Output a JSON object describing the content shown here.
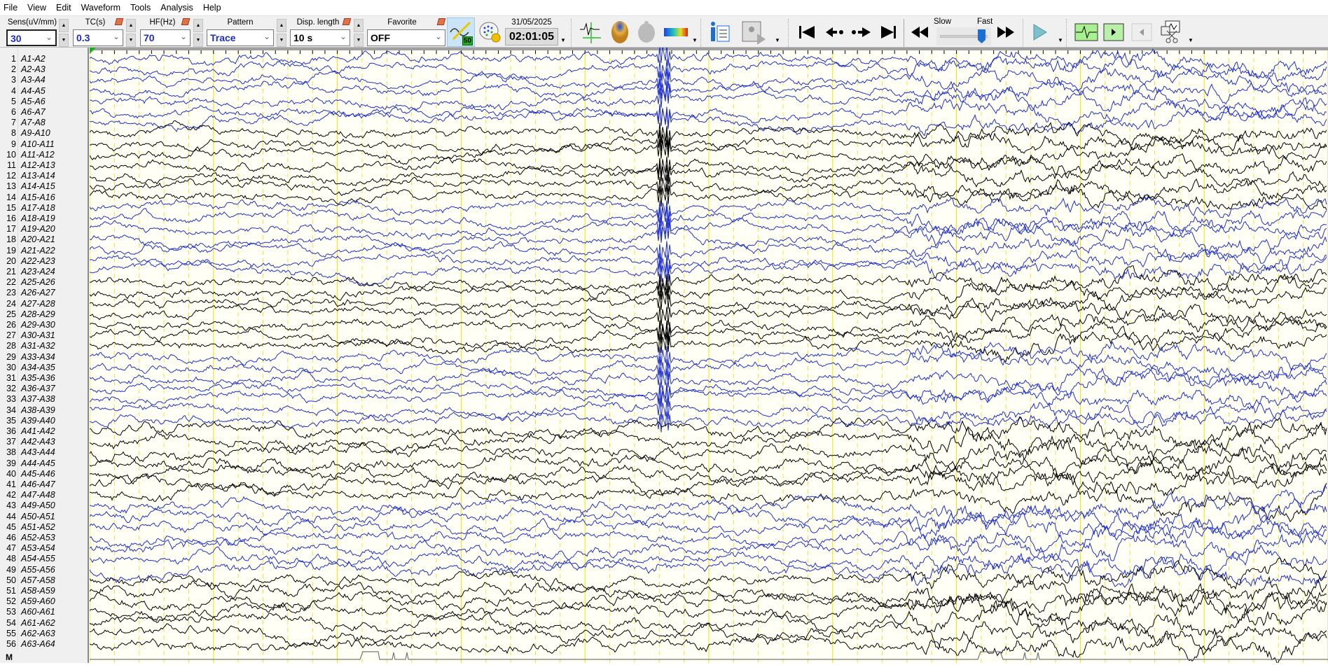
{
  "menu": [
    "File",
    "View",
    "Edit",
    "Waveform",
    "Tools",
    "Analysis",
    "Help"
  ],
  "toolbar": {
    "sens": {
      "label": "Sens(uV/mm)",
      "value": "30"
    },
    "tc": {
      "label": "TC(s)",
      "value": "0.3"
    },
    "hf": {
      "label": "HF(Hz)",
      "value": "70"
    },
    "pattern": {
      "label": "Pattern",
      "value": "Trace"
    },
    "disp_length": {
      "label": "Disp. length",
      "value": "10 s"
    },
    "favorite": {
      "label": "Favorite",
      "value": "OFF"
    },
    "filter_badge": "50",
    "date": "31/05/2025",
    "time": "02:01:05",
    "speed_slow": "Slow",
    "speed_fast": "Fast",
    "speed_level": 0.9
  },
  "colors": {
    "blue": "#1f2fd0",
    "black": "#000000",
    "grid_solid": "#f0e000",
    "grid_dashed": "#f0e040",
    "accent": "#1d2cc4"
  },
  "channels": [
    "A1-A2",
    "A2-A3",
    "A3-A4",
    "A4-A5",
    "A5-A6",
    "A6-A7",
    "A7-A8",
    "A9-A10",
    "A10-A11",
    "A11-A12",
    "A12-A13",
    "A13-A14",
    "A14-A15",
    "A15-A16",
    "A17-A18",
    "A18-A19",
    "A19-A20",
    "A20-A21",
    "A21-A22",
    "A22-A23",
    "A23-A24",
    "A25-A26",
    "A26-A27",
    "A27-A28",
    "A28-A29",
    "A29-A30",
    "A30-A31",
    "A31-A32",
    "A33-A34",
    "A34-A35",
    "A35-A36",
    "A36-A37",
    "A37-A38",
    "A38-A39",
    "A39-A40",
    "A41-A42",
    "A42-A43",
    "A43-A44",
    "A44-A45",
    "A45-A46",
    "A46-A47",
    "A47-A48",
    "A49-A50",
    "A50-A51",
    "A51-A52",
    "A52-A53",
    "A53-A54",
    "A54-A55",
    "A55-A56",
    "A57-A58",
    "A58-A59",
    "A59-A60",
    "A60-A61",
    "A61-A62",
    "A62-A63",
    "A63-A64"
  ],
  "marker_label": "M"
}
